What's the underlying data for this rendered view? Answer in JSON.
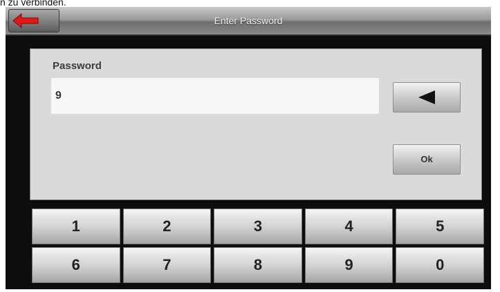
{
  "caption": "n zu verbinden.",
  "titlebar": {
    "title": "Enter Password",
    "back_icon": "back-arrow-icon",
    "back_icon_color": "#e01818"
  },
  "password": {
    "label": "Password",
    "value": "9"
  },
  "buttons": {
    "backspace_icon": "backspace-triangle-icon",
    "ok_label": "Ok"
  },
  "keypad": {
    "keys": [
      "1",
      "2",
      "3",
      "4",
      "5",
      "6",
      "7",
      "8",
      "9",
      "0"
    ]
  }
}
